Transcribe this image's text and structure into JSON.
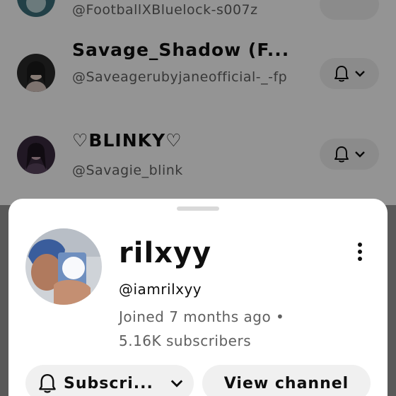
{
  "channels": [
    {
      "name": "",
      "handle": "@FootballXBluelock-s007z"
    },
    {
      "name": "Savage_Shadow (F...",
      "handle": "@Saveagerubyjaneofficial-_-fp"
    },
    {
      "name": "♡BLINKY♡",
      "handle": "@Savagie_blink"
    }
  ],
  "sheet": {
    "name": "rilxyy",
    "handle": "@iamrilxyy",
    "joined": "Joined 7 months ago •",
    "subscribers": "5.16K subscribers",
    "subscribe_label": "Subscri...",
    "view_label": "View channel"
  },
  "icons": {
    "bell": "bell-icon",
    "chevron": "chevron-down-icon",
    "more": "more-vert-icon"
  }
}
